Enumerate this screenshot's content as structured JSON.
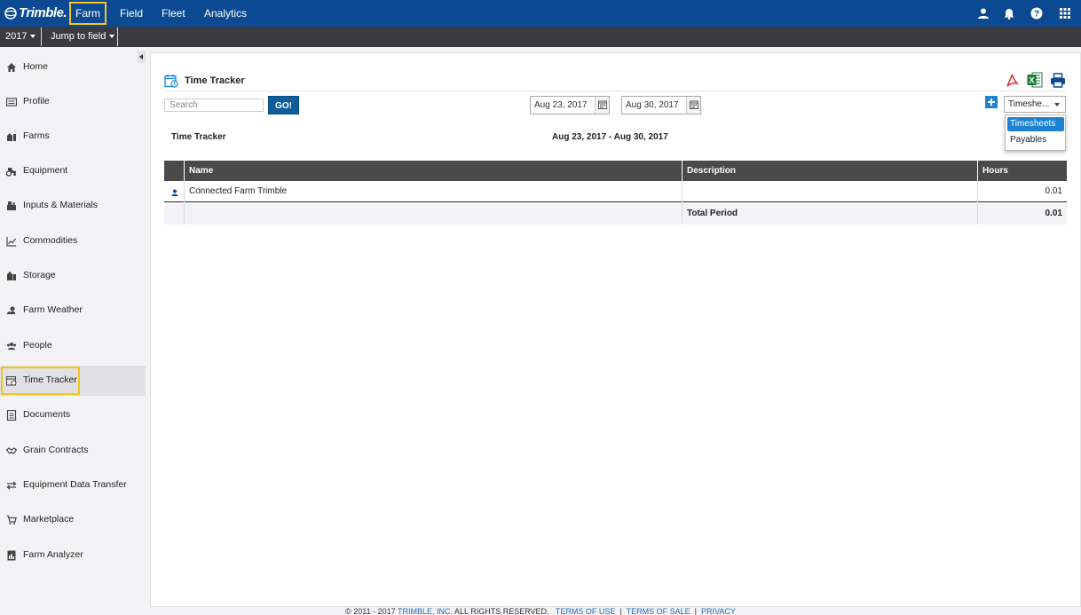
{
  "topbar": {
    "brand": "Trimble.",
    "nav": [
      {
        "label": "Farm"
      },
      {
        "label": "Field"
      },
      {
        "label": "Fleet"
      },
      {
        "label": "Analytics"
      }
    ],
    "icons": [
      "user-icon",
      "bell-icon",
      "help-icon",
      "apps-grid-icon"
    ]
  },
  "subbar": {
    "year": "2017",
    "jump": "Jump to field"
  },
  "sidebar": {
    "items": [
      {
        "label": "Home",
        "icon": "home-icon"
      },
      {
        "label": "Profile",
        "icon": "profile-icon"
      },
      {
        "label": "Farms",
        "icon": "farms-icon"
      },
      {
        "label": "Equipment",
        "icon": "tractor-icon"
      },
      {
        "label": "Inputs & Materials",
        "icon": "inputs-icon"
      },
      {
        "label": "Commodities",
        "icon": "chart-line-icon"
      },
      {
        "label": "Storage",
        "icon": "silo-icon"
      },
      {
        "label": "Farm Weather",
        "icon": "weather-icon"
      },
      {
        "label": "People",
        "icon": "people-icon"
      },
      {
        "label": "Time Tracker",
        "icon": "calendar-clock-icon"
      },
      {
        "label": "Documents",
        "icon": "document-icon"
      },
      {
        "label": "Grain Contracts",
        "icon": "handshake-icon"
      },
      {
        "label": "Equipment Data Transfer",
        "icon": "transfer-icon"
      },
      {
        "label": "Marketplace",
        "icon": "cart-icon"
      },
      {
        "label": "Farm Analyzer",
        "icon": "analyzer-icon"
      }
    ],
    "active": "Time Tracker"
  },
  "main": {
    "title": "Time Tracker",
    "search_placeholder": "Search",
    "go_label": "GO!",
    "start_date": "Aug 23, 2017",
    "end_date": "Aug 30, 2017",
    "view_select": "Timeshe...",
    "view_options": [
      "Timesheets",
      "Payables"
    ],
    "report_title": "Time Tracker",
    "report_range": "Aug 23, 2017 - Aug 30, 2017",
    "table": {
      "columns": [
        "",
        "Name",
        "Description",
        "Hours"
      ],
      "rows": [
        {
          "name": "Connected Farm Trimble",
          "description": "",
          "hours": "0.01"
        }
      ],
      "total_label": "Total Period",
      "total_hours": "0.01"
    },
    "export_icons": [
      "pdf-icon",
      "excel-icon",
      "print-icon"
    ]
  },
  "footer": {
    "copyright": "© 2011 - 2017",
    "company": "TRIMBLE, INC.",
    "rights": "ALL RIGHTS RESERVED.",
    "terms_use": "TERMS OF USE",
    "terms_sale": "TERMS OF SALE",
    "privacy": "PRIVACY",
    "separator": "|"
  },
  "colors": {
    "topbar": "#0b4a93",
    "subbar": "#3a3a40",
    "accent": "#1e82d4",
    "highlight": "#f5c518"
  }
}
